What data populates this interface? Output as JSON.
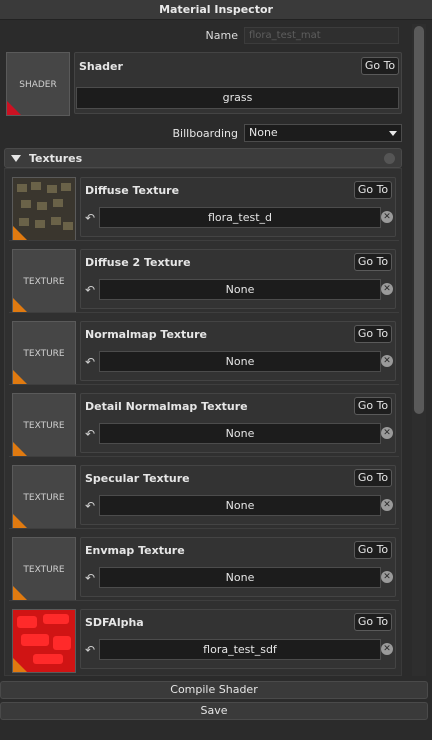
{
  "window": {
    "title": "Material Inspector"
  },
  "name": {
    "label": "Name",
    "value": "flora_test_mat"
  },
  "shader": {
    "thumb_label": "SHADER",
    "title": "Shader",
    "goto_label": "Go To",
    "value": "grass"
  },
  "billboarding": {
    "label": "Billboarding",
    "value": "None"
  },
  "textures": {
    "header": "Textures",
    "items": [
      {
        "title": "Diffuse Texture",
        "goto_label": "Go To",
        "value": "flora_test_d",
        "thumb_label": ""
      },
      {
        "title": "Diffuse 2 Texture",
        "goto_label": "Go To",
        "value": "None",
        "thumb_label": "TEXTURE"
      },
      {
        "title": "Normalmap Texture",
        "goto_label": "Go To",
        "value": "None",
        "thumb_label": "TEXTURE"
      },
      {
        "title": "Detail Normalmap Texture",
        "goto_label": "Go To",
        "value": "None",
        "thumb_label": "TEXTURE"
      },
      {
        "title": "Specular Texture",
        "goto_label": "Go To",
        "value": "None",
        "thumb_label": "TEXTURE"
      },
      {
        "title": "Envmap Texture",
        "goto_label": "Go To",
        "value": "None",
        "thumb_label": "TEXTURE"
      },
      {
        "title": "SDFAlpha",
        "goto_label": "Go To",
        "value": "flora_test_sdf",
        "thumb_label": ""
      }
    ]
  },
  "footer": {
    "compile_label": "Compile Shader",
    "save_label": "Save"
  },
  "colors": {
    "background": "#2b2b2b",
    "accent_orange": "#e07a10",
    "accent_red": "#cc1122",
    "field": "#1c1c1c"
  }
}
